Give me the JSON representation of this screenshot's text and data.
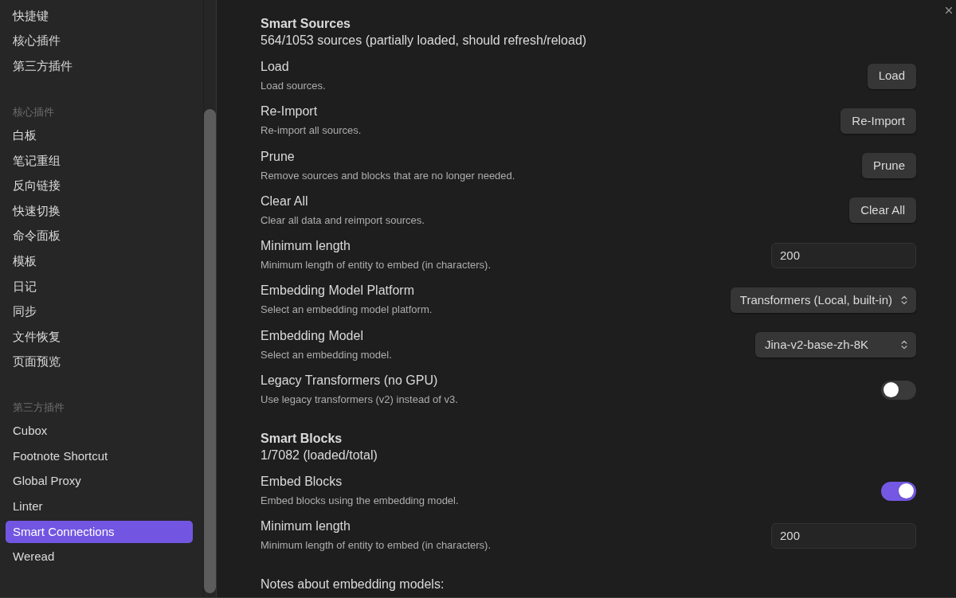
{
  "sidebar": {
    "groups": [
      {
        "items": [
          {
            "label": "快捷键",
            "selected": false
          },
          {
            "label": "核心插件",
            "selected": false
          },
          {
            "label": "第三方插件",
            "selected": false
          }
        ]
      },
      {
        "heading": "核心插件",
        "items": [
          {
            "label": "白板",
            "selected": false
          },
          {
            "label": "笔记重组",
            "selected": false
          },
          {
            "label": "反向链接",
            "selected": false
          },
          {
            "label": "快速切换",
            "selected": false
          },
          {
            "label": "命令面板",
            "selected": false
          },
          {
            "label": "模板",
            "selected": false
          },
          {
            "label": "日记",
            "selected": false
          },
          {
            "label": "同步",
            "selected": false
          },
          {
            "label": "文件恢复",
            "selected": false
          },
          {
            "label": "页面预览",
            "selected": false
          }
        ]
      },
      {
        "heading": "第三方插件",
        "items": [
          {
            "label": "Cubox",
            "selected": false
          },
          {
            "label": "Footnote Shortcut",
            "selected": false
          },
          {
            "label": "Global Proxy",
            "selected": false
          },
          {
            "label": "Linter",
            "selected": false
          },
          {
            "label": "Smart Connections",
            "selected": true
          },
          {
            "label": "Weread",
            "selected": false
          }
        ]
      }
    ]
  },
  "sections": [
    {
      "title": "Smart Sources",
      "status": "564/1053 sources (partially loaded, should refresh/reload)",
      "settings": [
        {
          "kind": "button",
          "name": "Load",
          "description": "Load sources.",
          "button_label": "Load"
        },
        {
          "kind": "button",
          "name": "Re-Import",
          "description": "Re-import all sources.",
          "button_label": "Re-Import"
        },
        {
          "kind": "button",
          "name": "Prune",
          "description": "Remove sources and blocks that are no longer needed.",
          "button_label": "Prune"
        },
        {
          "kind": "button",
          "name": "Clear All",
          "description": "Clear all data and reimport sources.",
          "button_label": "Clear All"
        },
        {
          "kind": "input",
          "name": "Minimum length",
          "description": "Minimum length of entity to embed (in characters).",
          "value": "200"
        },
        {
          "kind": "select",
          "name": "Embedding Model Platform",
          "description": "Select an embedding model platform.",
          "value": "Transformers (Local, built-in)"
        },
        {
          "kind": "select",
          "name": "Embedding Model",
          "description": "Select an embedding model.",
          "value": "Jina-v2-base-zh-8K"
        },
        {
          "kind": "toggle",
          "name": "Legacy Transformers (no GPU)",
          "description": "Use legacy transformers (v2) instead of v3.",
          "on": false
        }
      ]
    },
    {
      "title": "Smart Blocks",
      "status": "1/7082 (loaded/total)",
      "settings": [
        {
          "kind": "toggle",
          "name": "Embed Blocks",
          "description": "Embed blocks using the embedding model.",
          "on": true
        },
        {
          "kind": "input",
          "name": "Minimum length",
          "description": "Minimum length of entity to embed (in characters).",
          "value": "200"
        }
      ]
    }
  ],
  "notes_heading": "Notes about embedding models:"
}
